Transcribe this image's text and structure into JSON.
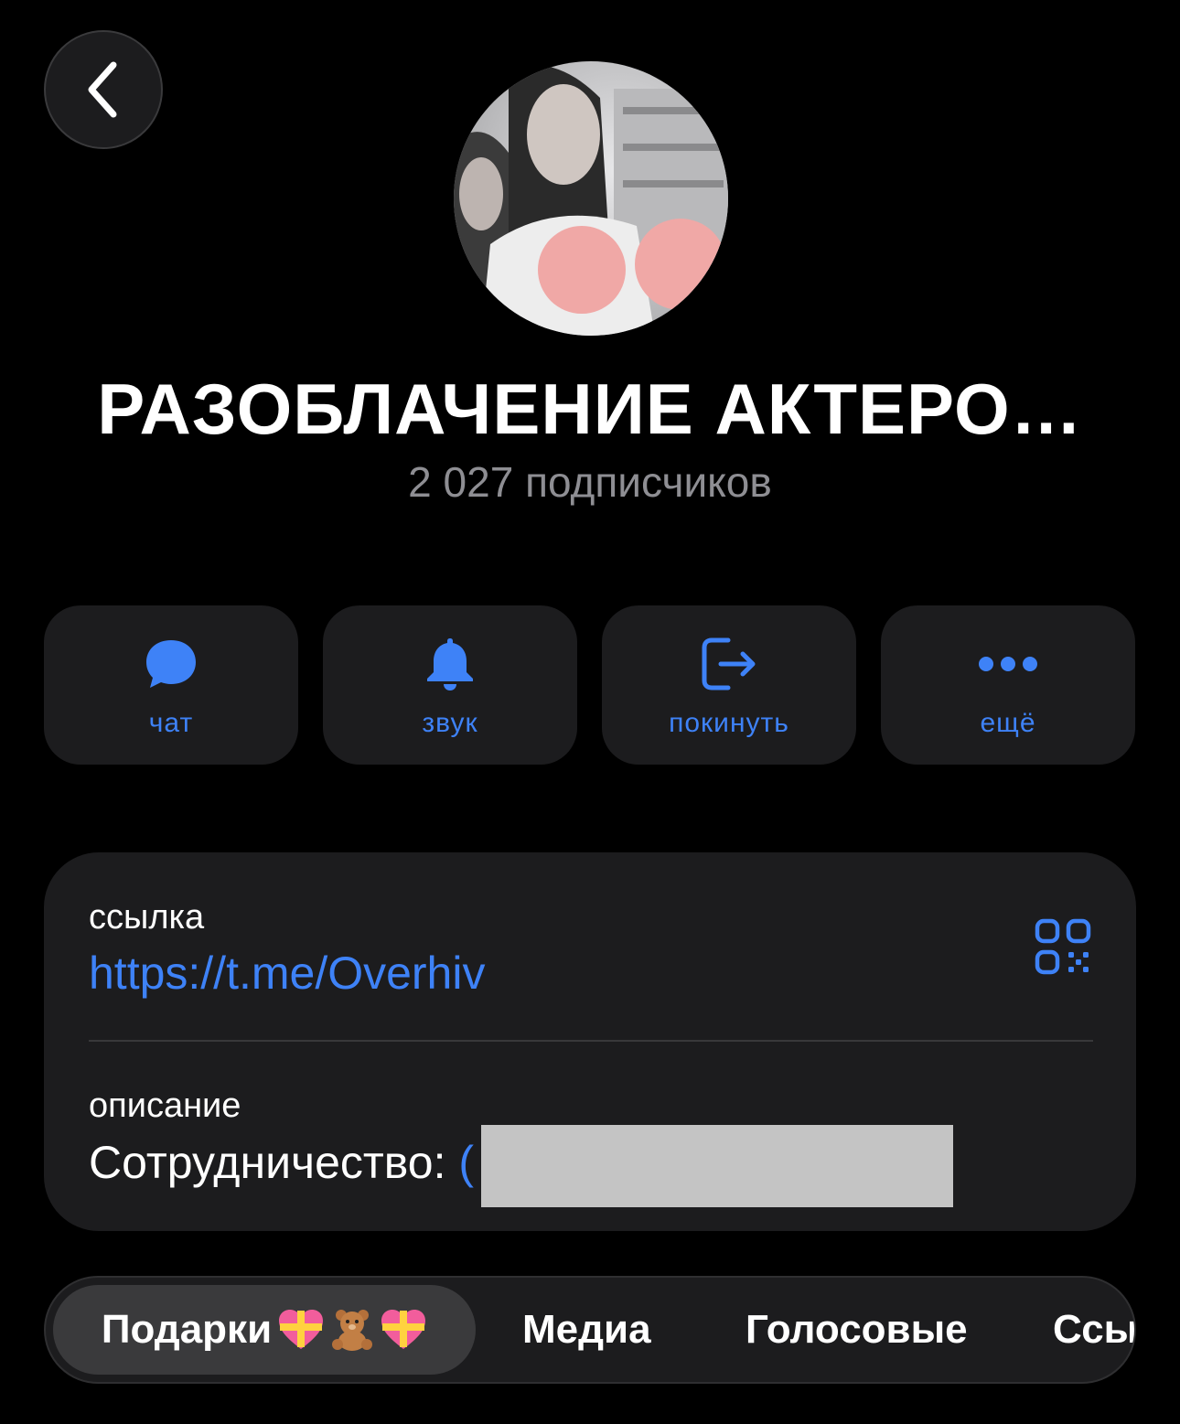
{
  "header": {
    "back_icon": "chevron-left-icon"
  },
  "channel": {
    "title": "РАЗОБЛАЧЕНИЕ АКТЕРО…",
    "subscribers": "2 027 подписчиков"
  },
  "actions": [
    {
      "label": "чат",
      "icon": "chat-bubble-icon"
    },
    {
      "label": "звук",
      "icon": "bell-icon"
    },
    {
      "label": "покинуть",
      "icon": "leave-icon"
    },
    {
      "label": "ещё",
      "icon": "more-dots-icon"
    }
  ],
  "info": {
    "link_label": "ссылка",
    "link_value": "https://t.me/Overhiv",
    "qr_icon": "qr-code-icon",
    "description_label": "описание",
    "description_value": "Сотрудничество: ",
    "description_link_fragment": "("
  },
  "tabs": [
    {
      "label": "Подарки",
      "active": true,
      "emojis": [
        "heart-gift-icon",
        "teddy-bear-icon",
        "heart-gift-icon"
      ]
    },
    {
      "label": "Медиа",
      "active": false
    },
    {
      "label": "Голосовые",
      "active": false
    },
    {
      "label": "Ссы",
      "active": false
    }
  ],
  "colors": {
    "accent": "#3e82f7",
    "background": "#000000",
    "card": "#1c1c1e",
    "secondary_text": "#8e8e93"
  }
}
